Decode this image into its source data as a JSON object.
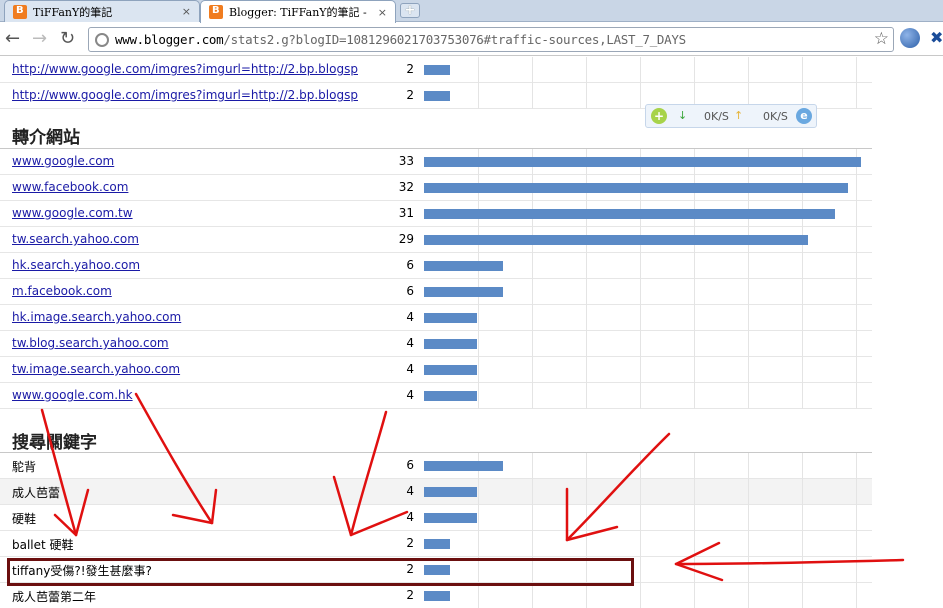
{
  "browser": {
    "tabs": [
      {
        "title": "TiFFanY的筆記",
        "active": false
      },
      {
        "title": "Blogger: TiFFanY的筆記 - ",
        "active": true
      }
    ],
    "tab_close": "×",
    "newtab_label": "+",
    "url_host": "www.blogger.com",
    "url_path": "/stats2.g?blogID=1081296021703753076#traffic-sources,LAST_7_DAYS",
    "icons": [
      "back-icon",
      "forward-icon",
      "reload-icon",
      "globe-icon",
      "star-icon",
      "extension-globe-icon",
      "tools-icon"
    ]
  },
  "speed_widget": {
    "down": "0K/S",
    "up": "0K/S"
  },
  "image_rows": [
    {
      "label": "http://www.google.com/imgres?imgurl=http://2.bp.blogsp",
      "count": "2",
      "value": 2
    },
    {
      "label": "http://www.google.com/imgres?imgurl=http://2.bp.blogsp",
      "count": "2",
      "value": 2
    }
  ],
  "referrers": {
    "title": "轉介網站",
    "rows": [
      {
        "label": "www.google.com",
        "count": "33",
        "value": 33
      },
      {
        "label": "www.facebook.com",
        "count": "32",
        "value": 32
      },
      {
        "label": "www.google.com.tw",
        "count": "31",
        "value": 31
      },
      {
        "label": "tw.search.yahoo.com",
        "count": "29",
        "value": 29
      },
      {
        "label": "hk.search.yahoo.com",
        "count": "6",
        "value": 6
      },
      {
        "label": "m.facebook.com",
        "count": "6",
        "value": 6
      },
      {
        "label": "hk.image.search.yahoo.com",
        "count": "4",
        "value": 4
      },
      {
        "label": "tw.blog.search.yahoo.com",
        "count": "4",
        "value": 4
      },
      {
        "label": "tw.image.search.yahoo.com",
        "count": "4",
        "value": 4
      },
      {
        "label": "www.google.com.hk",
        "count": "4",
        "value": 4
      }
    ]
  },
  "keywords": {
    "title": "搜尋關鍵字",
    "rows": [
      {
        "label": "駝背",
        "count": "6",
        "value": 6
      },
      {
        "label": "成人芭蕾",
        "count": "4",
        "value": 4
      },
      {
        "label": "硬鞋",
        "count": "4",
        "value": 4
      },
      {
        "label": "ballet 硬鞋",
        "count": "2",
        "value": 2
      },
      {
        "label": "tiffany受傷?!發生甚麼事?",
        "count": "2",
        "value": 2
      },
      {
        "label": "成人芭蕾第二年",
        "count": "2",
        "value": 2
      }
    ]
  },
  "annotation_color": "#e01010",
  "highlight_color": "#6b0f0f",
  "bar_color": "#5b8ac6"
}
